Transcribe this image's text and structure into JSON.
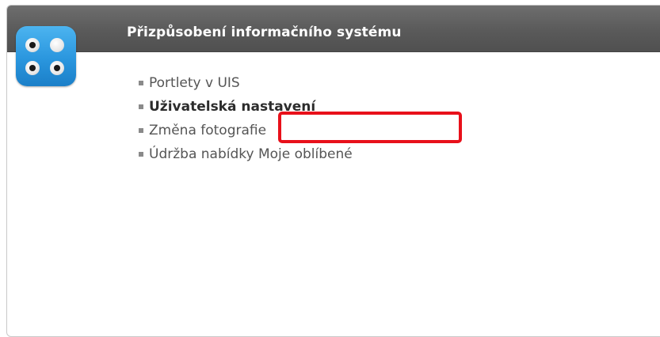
{
  "portlet": {
    "title": "Přizpůsobení informačního systému",
    "icon": "four-dots-app-icon",
    "accent_color": "#2a96de",
    "header_color": "#5f5f5f",
    "menu_items": [
      {
        "label": "Portlety v UIS",
        "active": false
      },
      {
        "label": "Uživatelská nastavení",
        "active": true
      },
      {
        "label": "Změna fotografie",
        "active": false
      },
      {
        "label": "Údržba nabídky Moje oblíbené",
        "active": false
      }
    ]
  },
  "annotation": {
    "highlight_color": "#e8101a",
    "target": "Změna fotografie"
  }
}
